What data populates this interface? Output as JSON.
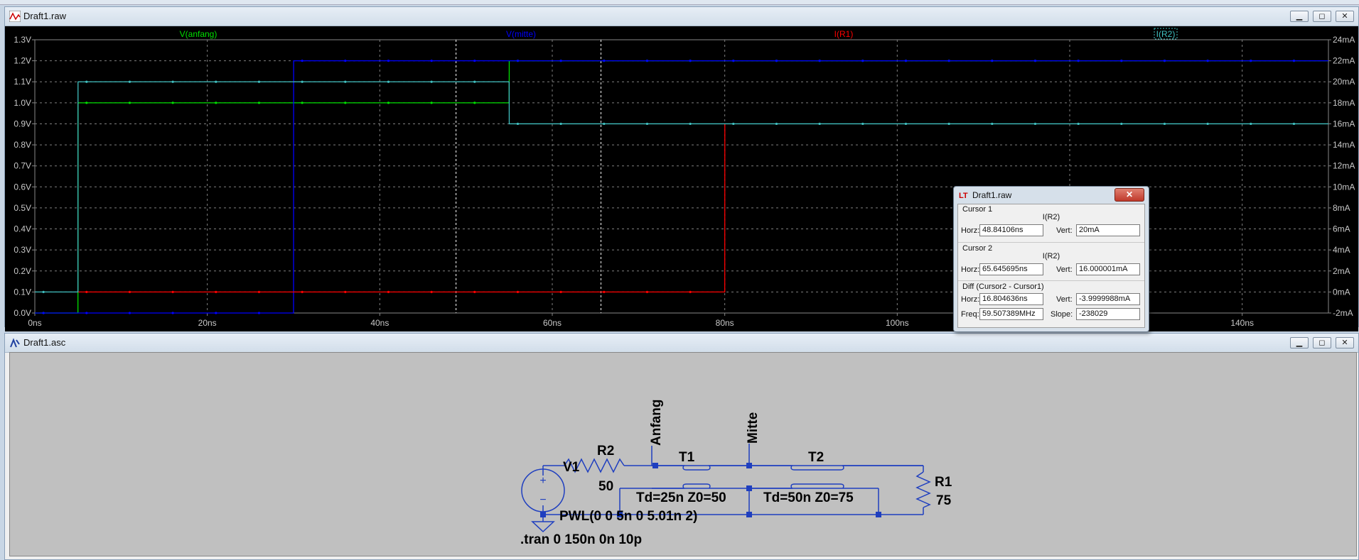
{
  "waveform_window": {
    "title": "Draft1.raw",
    "traces": [
      {
        "name": "V(anfang)",
        "color": "#00e000"
      },
      {
        "name": "V(mitte)",
        "color": "#0000ff"
      },
      {
        "name": "I(R1)",
        "color": "#ff0000"
      },
      {
        "name": "I(R2)",
        "color": "#40c0c0"
      }
    ]
  },
  "schematic_window": {
    "title": "Draft1.asc",
    "labels": {
      "v1": "V1",
      "r2": "R2",
      "r2_value": "50",
      "anfang": "Anfang",
      "mitte": "Mitte",
      "t1": "T1",
      "t1_value": "Td=25n Z0=50",
      "t2": "T2",
      "t2_value": "Td=50n Z0=75",
      "r1": "R1",
      "r1_value": "75",
      "pwl": "PWL(0 0 5n 0 5.01n 2)",
      "tran": ".tran 0 150n 0n 10p"
    }
  },
  "cursor_dialog": {
    "title": "Draft1.raw",
    "close_label": "✕",
    "cursor1": {
      "label": "Cursor 1",
      "trace": "I(R2)",
      "horz_label": "Horz:",
      "horz": "48.84106ns",
      "vert_label": "Vert:",
      "vert": "20mA"
    },
    "cursor2": {
      "label": "Cursor 2",
      "trace": "I(R2)",
      "horz_label": "Horz:",
      "horz": "65.645695ns",
      "vert_label": "Vert:",
      "vert": "16.000001mA"
    },
    "diff": {
      "label": "Diff (Cursor2 - Cursor1)",
      "horz_label": "Horz:",
      "horz": "16.804636ns",
      "vert_label": "Vert:",
      "vert": "-3.9999988mA",
      "freq_label": "Freq:",
      "freq": "59.507389MHz",
      "slope_label": "Slope:",
      "slope": "-238029"
    }
  },
  "chart_data": {
    "type": "line",
    "xlabel": "",
    "xlim": [
      0,
      150
    ],
    "x_ticks": [
      "0ns",
      "20ns",
      "40ns",
      "60ns",
      "80ns",
      "100ns",
      "120ns",
      "140ns"
    ],
    "y_left_ticks": [
      "0.0V",
      "0.1V",
      "0.2V",
      "0.3V",
      "0.4V",
      "0.5V",
      "0.6V",
      "0.7V",
      "0.8V",
      "0.9V",
      "1.0V",
      "1.1V",
      "1.2V",
      "1.3V"
    ],
    "y_right_ticks": [
      "-2mA",
      "0mA",
      "2mA",
      "4mA",
      "6mA",
      "8mA",
      "10mA",
      "12mA",
      "14mA",
      "16mA",
      "18mA",
      "20mA",
      "22mA",
      "24mA"
    ],
    "ylim_left": [
      0,
      1.3
    ],
    "ylim_right": [
      -2,
      24
    ],
    "grid": true,
    "cursors_x_ns": [
      48.84106,
      65.645695
    ],
    "series": [
      {
        "name": "V(anfang)",
        "axis": "left",
        "color": "#00e000",
        "x": [
          0,
          5,
          5.01,
          55,
          55.01,
          150
        ],
        "y": [
          0,
          0,
          1.0,
          1.0,
          1.2,
          1.2
        ]
      },
      {
        "name": "V(mitte)",
        "axis": "left",
        "color": "#0000ff",
        "x": [
          0,
          30,
          30.01,
          150
        ],
        "y": [
          0,
          0,
          1.2,
          1.2
        ]
      },
      {
        "name": "I(R1)",
        "axis": "right",
        "color": "#ff0000",
        "x": [
          5,
          80,
          80.01
        ],
        "y": [
          0,
          0,
          16
        ]
      },
      {
        "name": "I(R2)",
        "axis": "right",
        "color": "#40c0c0",
        "x": [
          0,
          5,
          5.01,
          55,
          55.01,
          150
        ],
        "y": [
          0,
          0,
          20,
          20,
          16,
          16
        ]
      }
    ]
  }
}
